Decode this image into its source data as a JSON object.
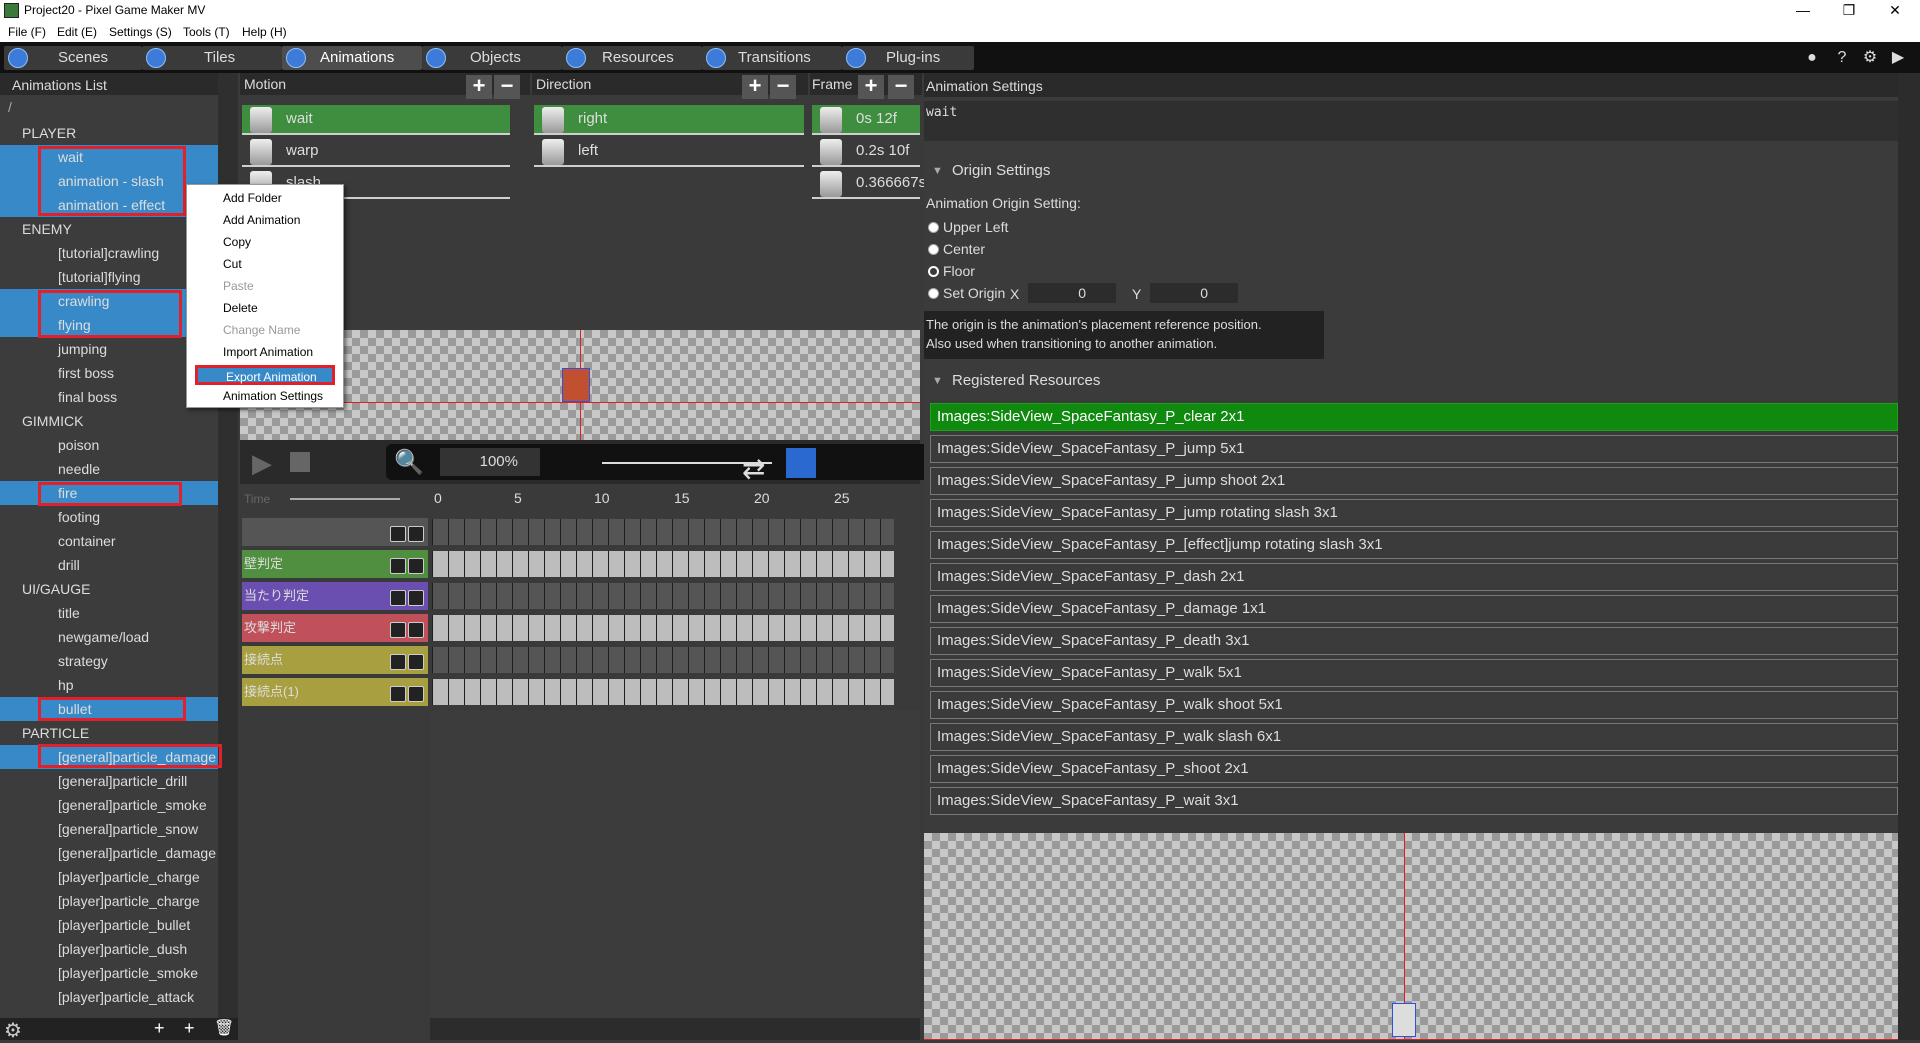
{
  "window": {
    "title": "Project20 - Pixel Game Maker MV",
    "controls": [
      "—",
      "❐",
      "✕"
    ]
  },
  "menubar": [
    "File (F)",
    "Edit (E)",
    "Settings (S)",
    "Tools (T)",
    "Help (H)"
  ],
  "tabs": [
    {
      "label": "Scenes"
    },
    {
      "label": "Tiles"
    },
    {
      "label": "Animations"
    },
    {
      "label": "Objects"
    },
    {
      "label": "Resources"
    },
    {
      "label": "Transitions"
    },
    {
      "label": "Plug-ins"
    }
  ],
  "animations_list": {
    "title": "Animations List",
    "root": "/",
    "rows": [
      {
        "label": "PLAYER",
        "type": "folder"
      },
      {
        "label": "wait",
        "type": "item",
        "selected": true
      },
      {
        "label": "animation - slash",
        "type": "item",
        "selected": true
      },
      {
        "label": "animation - effect",
        "type": "item",
        "selected": true
      },
      {
        "label": "ENEMY",
        "type": "folder"
      },
      {
        "label": "[tutorial]crawling",
        "type": "item"
      },
      {
        "label": "[tutorial]flying",
        "type": "item"
      },
      {
        "label": "crawling",
        "type": "item",
        "selected": true
      },
      {
        "label": "flying",
        "type": "item",
        "selected": true
      },
      {
        "label": "jumping",
        "type": "item"
      },
      {
        "label": "first boss",
        "type": "item"
      },
      {
        "label": "final boss",
        "type": "item"
      },
      {
        "label": "GIMMICK",
        "type": "folder"
      },
      {
        "label": "poison",
        "type": "item"
      },
      {
        "label": "needle",
        "type": "item"
      },
      {
        "label": "fire",
        "type": "item",
        "selected": true
      },
      {
        "label": "footing",
        "type": "item"
      },
      {
        "label": "container",
        "type": "item"
      },
      {
        "label": "drill",
        "type": "item"
      },
      {
        "label": "UI/GAUGE",
        "type": "folder"
      },
      {
        "label": "title",
        "type": "item"
      },
      {
        "label": "newgame/load",
        "type": "item"
      },
      {
        "label": "strategy",
        "type": "item"
      },
      {
        "label": "hp",
        "type": "item"
      },
      {
        "label": "bullet",
        "type": "item",
        "selected": true
      },
      {
        "label": "PARTICLE",
        "type": "folder"
      },
      {
        "label": "[general]particle_damage",
        "type": "particle",
        "selected": true
      },
      {
        "label": "[general]particle_drill",
        "type": "particle"
      },
      {
        "label": "[general]particle_smoke",
        "type": "particle"
      },
      {
        "label": "[general]particle_snow",
        "type": "particle"
      },
      {
        "label": "[general]particle_damage",
        "type": "particle"
      },
      {
        "label": "[player]particle_charge",
        "type": "particle"
      },
      {
        "label": "[player]particle_charge",
        "type": "particle"
      },
      {
        "label": "[player]particle_bullet",
        "type": "particle"
      },
      {
        "label": "[player]particle_dush",
        "type": "particle"
      },
      {
        "label": "[player]particle_smoke",
        "type": "particle"
      },
      {
        "label": "[player]particle_attack",
        "type": "particle"
      }
    ]
  },
  "context_menu": [
    {
      "label": "Add Folder",
      "enabled": true
    },
    {
      "label": "Add Animation",
      "enabled": true
    },
    {
      "label": "Copy",
      "enabled": true
    },
    {
      "label": "Cut",
      "enabled": true
    },
    {
      "label": "Paste",
      "enabled": false
    },
    {
      "label": "Delete",
      "enabled": true
    },
    {
      "label": "Change Name",
      "enabled": false
    },
    {
      "label": "Import Animation",
      "enabled": true
    },
    {
      "label": "Export Animation",
      "enabled": true,
      "highlighted": true
    },
    {
      "label": "Animation Settings",
      "enabled": true
    }
  ],
  "motion": {
    "header": "Motion",
    "items": [
      "wait",
      "warp",
      "slash"
    ]
  },
  "direction": {
    "header": "Direction",
    "items": [
      "right",
      "left"
    ]
  },
  "frame": {
    "header": "Frame",
    "items": [
      "0s 12f",
      "0.2s 10f",
      "0.366667s"
    ]
  },
  "playback": {
    "zoom": "100%"
  },
  "timeline": {
    "time_label": "Time",
    "ruler": [
      "0",
      "5",
      "10",
      "15",
      "20",
      "25"
    ],
    "tracks": [
      {
        "label": "",
        "color": "#555555"
      },
      {
        "label": "壁判定",
        "color": "#4f8f3f"
      },
      {
        "label": "当たり判定",
        "color": "#6a4fb0"
      },
      {
        "label": "攻撃判定",
        "color": "#c0505a"
      },
      {
        "label": "接続点",
        "color": "#a8a040"
      },
      {
        "label": "接続点(1)",
        "color": "#a8a040"
      }
    ]
  },
  "settings": {
    "header": "Animation Settings",
    "name_value": "wait",
    "origin_section": "Origin Settings",
    "origin_label": "Animation Origin Setting:",
    "origin_options": [
      "Upper Left",
      "Center",
      "Floor",
      "Set Origin"
    ],
    "origin_selected": "Floor",
    "x_label": "X",
    "x_value": "0",
    "y_label": "Y",
    "y_value": "0",
    "origin_note_1": "The origin is the animation's placement reference position.",
    "origin_note_2": "Also used when transitioning to another animation.",
    "resources_section": "Registered Resources",
    "resources": [
      "Images:SideView_SpaceFantasy_P_clear 2x1",
      "Images:SideView_SpaceFantasy_P_jump 5x1",
      "Images:SideView_SpaceFantasy_P_jump shoot 2x1",
      "Images:SideView_SpaceFantasy_P_jump rotating slash 3x1",
      "Images:SideView_SpaceFantasy_P_[effect]jump rotating slash 3x1",
      "Images:SideView_SpaceFantasy_P_dash 2x1",
      "Images:SideView_SpaceFantasy_P_damage 1x1",
      "Images:SideView_SpaceFantasy_P_death 3x1",
      "Images:SideView_SpaceFantasy_P_walk 5x1",
      "Images:SideView_SpaceFantasy_P_walk shoot 5x1",
      "Images:SideView_SpaceFantasy_P_walk slash 6x1",
      "Images:SideView_SpaceFantasy_P_shoot 2x1",
      "Images:SideView_SpaceFantasy_P_wait 3x1"
    ],
    "selected_resource": 0
  }
}
